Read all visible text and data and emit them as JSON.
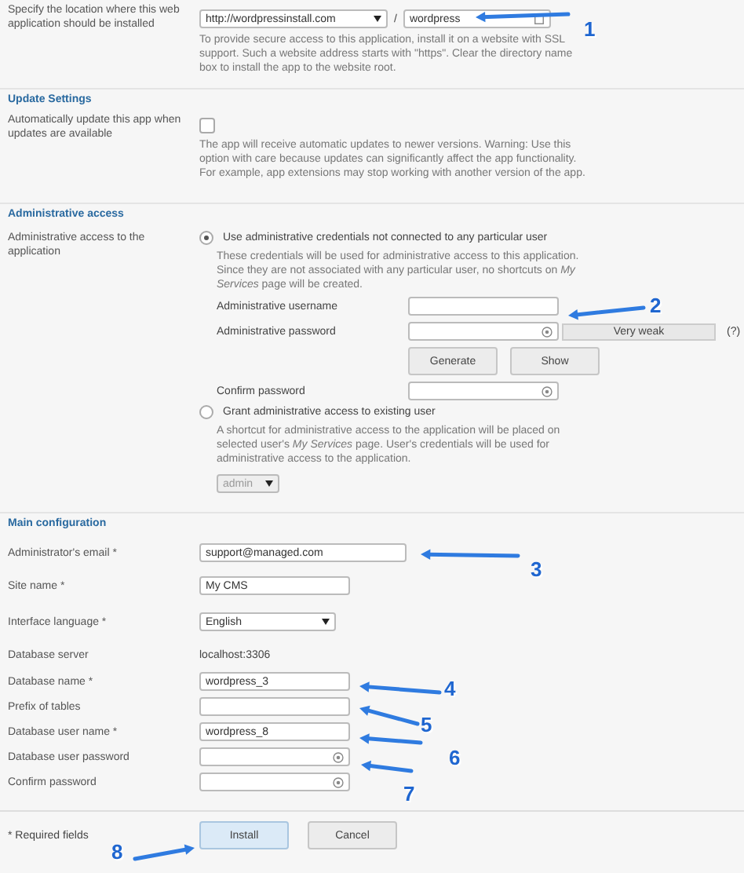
{
  "location": {
    "label": "Specify the location where this web application should be installed",
    "url": "http://wordpressinstall.com",
    "separator": "/",
    "directory": "wordpress",
    "hint": "To provide secure access to this application, install it on a website with SSL support. Such a website address starts with \"https\". Clear the directory name box to install the app to the website root."
  },
  "update_settings": {
    "heading": "Update Settings",
    "label": "Automatically update this app when updates are available",
    "checked": false,
    "hint": "The app will receive automatic updates to newer versions. Warning: Use this option with care because updates can significantly affect the app functionality. For example, app extensions may stop working with another version of the app."
  },
  "admin_access": {
    "heading": "Administrative access",
    "label": "Administrative access to the application",
    "options": [
      {
        "label": "Use administrative credentials not connected to any particular user",
        "selected": true,
        "description": "These credentials will be used for administrative access to this application. Since they are not associated with any particular user, no shortcuts on *My Services* page will be created."
      },
      {
        "label": "Grant administrative access to existing user",
        "selected": false,
        "description": "A shortcut for administrative access to the application will be placed on selected user's *My Services* page. User's credentials will be used for administrative access to the application."
      }
    ],
    "username_label": "Administrative username",
    "password_label": "Administrative password",
    "strength": "Very weak",
    "help": "(?)",
    "buttons": [
      "Generate",
      "Show"
    ],
    "confirm_label": "Confirm password",
    "user_select": "admin"
  },
  "main_config": {
    "heading": "Main configuration",
    "fields": [
      {
        "kind": "wide",
        "label": "Administrator's email *",
        "value": "support@managed.com"
      },
      {
        "kind": "text",
        "label": "Site name *",
        "value": "My CMS"
      },
      {
        "kind": "select",
        "label": "Interface language *",
        "value": "English"
      },
      {
        "kind": "static",
        "label": "Database server",
        "value": "localhost:3306"
      },
      {
        "kind": "text",
        "label": "Database name *",
        "value": "wordpress_3"
      },
      {
        "kind": "text",
        "label": "Prefix of tables"
      },
      {
        "kind": "text",
        "label": "Database user name *",
        "value": "wordpress_8"
      },
      {
        "kind": "password",
        "label": "Database user password"
      },
      {
        "kind": "password",
        "label": "Confirm password"
      }
    ]
  },
  "footer": {
    "note": "* Required fields",
    "buttons": [
      {
        "label": "Install",
        "kind": "primary"
      },
      {
        "label": "Cancel",
        "kind": "plain"
      }
    ]
  },
  "callouts": [
    {
      "number": "1"
    },
    {
      "number": "2"
    },
    {
      "number": "3"
    },
    {
      "number": "4"
    },
    {
      "number": "5"
    },
    {
      "number": "6"
    },
    {
      "number": "7"
    },
    {
      "number": "8"
    }
  ]
}
